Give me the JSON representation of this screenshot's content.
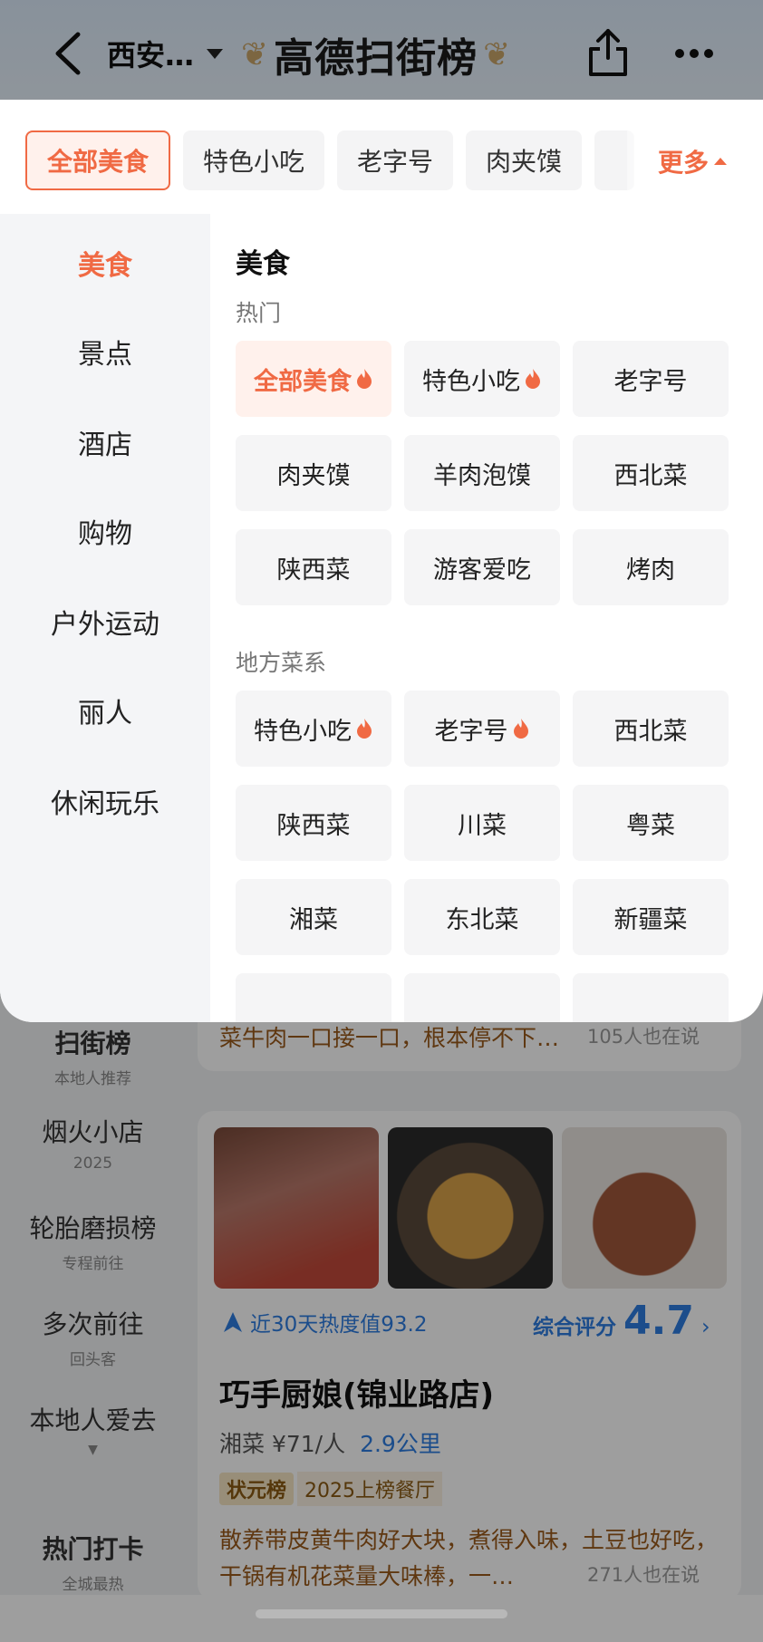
{
  "header": {
    "city": "西安…",
    "brand": "高德扫街榜"
  },
  "popup": {
    "chips": [
      "全部美食",
      "特色小吃",
      "老字号",
      "肉夹馍"
    ],
    "more_label": "更多",
    "sidebar": [
      "美食",
      "景点",
      "酒店",
      "购物",
      "户外运动",
      "丽人",
      "休闲玩乐"
    ],
    "section_title": "美食",
    "groups": [
      {
        "label": "热门",
        "items": [
          {
            "name": "全部美食",
            "hot": true,
            "active": true
          },
          {
            "name": "特色小吃",
            "hot": true
          },
          {
            "name": "老字号"
          },
          {
            "name": "肉夹馍"
          },
          {
            "name": "羊肉泡馍"
          },
          {
            "name": "西北菜"
          },
          {
            "name": "陕西菜"
          },
          {
            "name": "游客爱吃"
          },
          {
            "name": "烤肉"
          }
        ]
      },
      {
        "label": "地方菜系",
        "items": [
          {
            "name": "特色小吃",
            "hot": true
          },
          {
            "name": "老字号",
            "hot": true
          },
          {
            "name": "西北菜"
          },
          {
            "name": "陕西菜"
          },
          {
            "name": "川菜"
          },
          {
            "name": "粤菜"
          },
          {
            "name": "湘菜"
          },
          {
            "name": "东北菜"
          },
          {
            "name": "新疆菜"
          }
        ]
      }
    ]
  },
  "ranks": [
    {
      "title": "扫街榜",
      "sub": "本地人推荐"
    },
    {
      "title": "烟火小店",
      "sub": "2025"
    },
    {
      "title": "轮胎磨损榜",
      "sub": "专程前往"
    },
    {
      "title": "多次前往",
      "sub": "回头客"
    },
    {
      "title": "本地人爱去",
      "sub": ""
    },
    {
      "title": "热门打卡",
      "sub": "全城最热"
    }
  ],
  "listing": {
    "prev_review": "菜牛肉一口接一口，根本停不下…",
    "prev_review_count": "105人也在说",
    "heat_text": "近30天热度值93.2",
    "score_label": "综合评分",
    "score_value": "4.7",
    "name": "巧手厨娘(锦业路店)",
    "cuisine": "湘菜",
    "price": "¥71/人",
    "distance": "2.9公里",
    "badge": "状元榜",
    "badge_text": "2025上榜餐厅",
    "review": "散养带皮黄牛肉好大块，煮得入味，土豆也好吃，干锅有机花菜量大味棒，一…",
    "review_count": "271人也在说"
  },
  "colors": {
    "accent": "#f06a44",
    "blue": "#2e7de0"
  }
}
